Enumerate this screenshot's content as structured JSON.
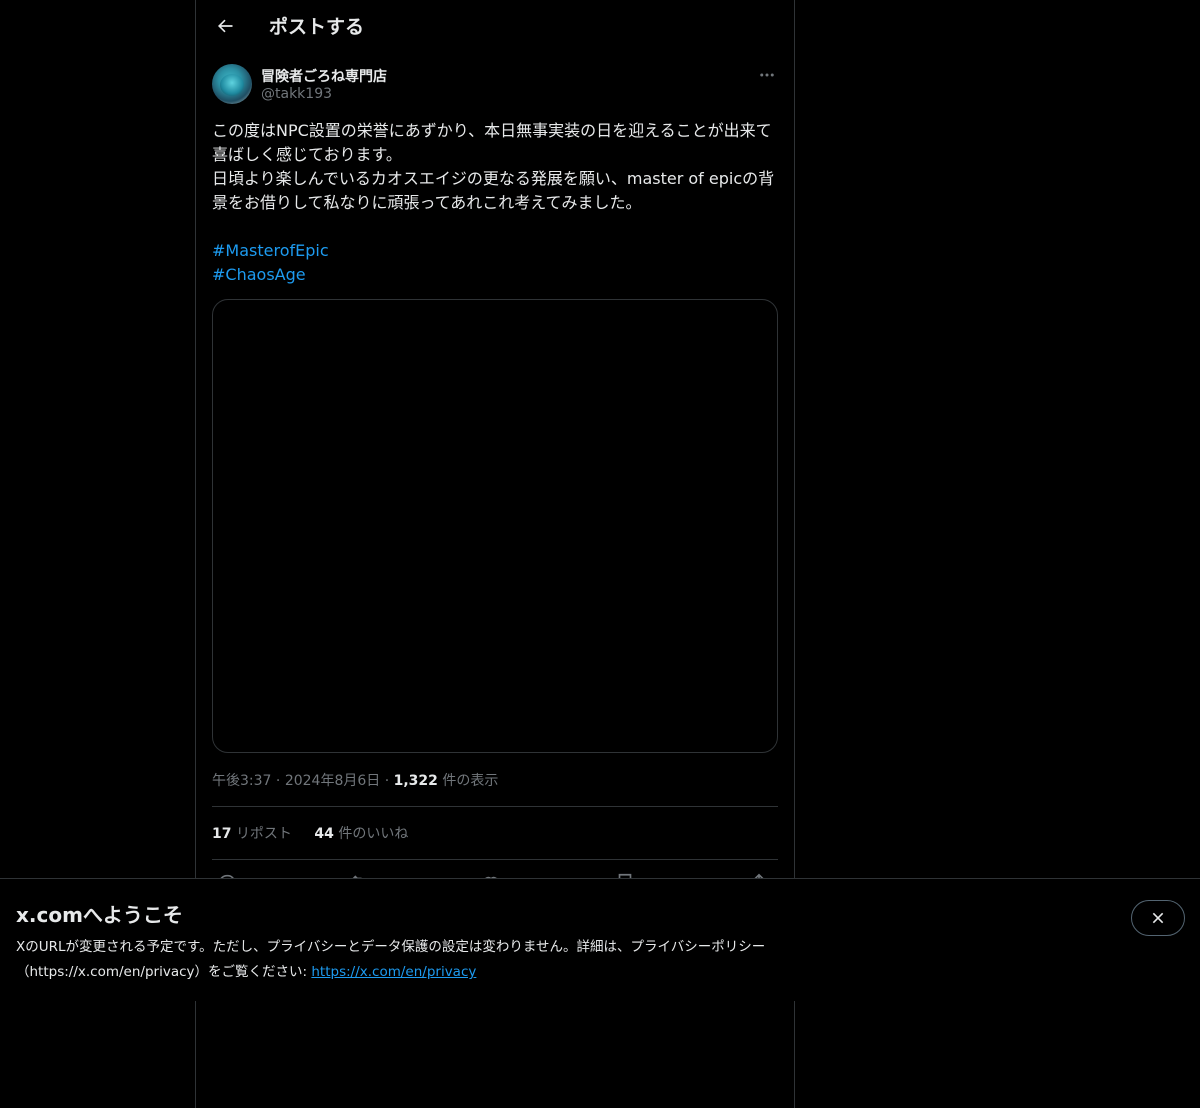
{
  "header": {
    "title": "ポストする"
  },
  "author": {
    "display_name": "冒険者ごろね専門店",
    "handle": "@takk193"
  },
  "post": {
    "text_line1": "この度はNPC設置の栄誉にあずかり、本日無事実装の日を迎えることが出来て喜ばしく感じております。",
    "text_line2": "日頃より楽しんでいるカオスエイジの更なる発展を願い、master of epicの背景をお借りして私なりに頑張ってあれこれ考えてみました。",
    "hashtags": [
      "#MasterofEpic",
      "#ChaosAge"
    ]
  },
  "meta": {
    "time": "午後3:37",
    "date": "2024年8月6日",
    "views_count": "1,322",
    "views_label": "件の表示"
  },
  "stats": {
    "reposts_count": "17",
    "reposts_label": "リポスト",
    "likes_count": "44",
    "likes_label": "件のいいね"
  },
  "banner": {
    "title": "x.comへようこそ",
    "text": "XのURLが変更される予定です。ただし、プライバシーとデータ保護の設定は変わりません。詳細は、プライバシーポリシー（https://x.com/en/privacy）をご覧ください: ",
    "link": "https://x.com/en/privacy"
  },
  "icons": {
    "back": "arrow-left-icon",
    "more": "more-dots-icon",
    "reply": "reply-icon",
    "repost": "repost-icon",
    "like": "heart-icon",
    "bookmark": "bookmark-icon",
    "share": "share-icon",
    "close": "close-icon"
  },
  "colors": {
    "accent": "#1d9bf0",
    "background": "#000000",
    "muted": "#71767b",
    "border": "#2f3336"
  }
}
